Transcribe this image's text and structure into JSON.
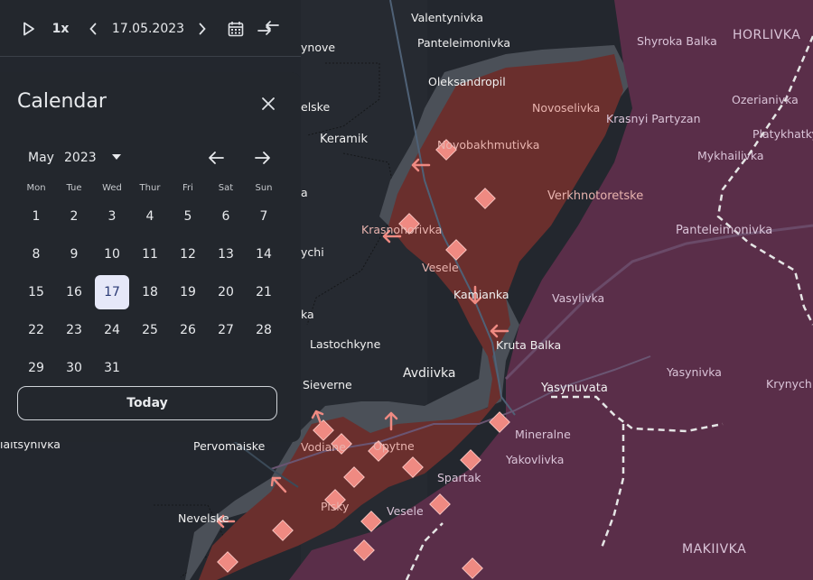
{
  "controls": {
    "play_icon": "play-icon",
    "speed": "1x",
    "date": "17.05.2023",
    "prev_icon": "chevron-left-icon",
    "next_icon": "chevron-right-icon",
    "calendar_icon": "calendar-icon",
    "compare_icon": "compare-arrows-icon"
  },
  "calendar": {
    "title": "Calendar",
    "close_icon": "close-icon",
    "month": "May",
    "year": "2023",
    "weekdays": [
      "Mon",
      "Tue",
      "Wed",
      "Thur",
      "Fri",
      "Sat",
      "Sun"
    ],
    "weeks": [
      [
        "1",
        "2",
        "3",
        "4",
        "5",
        "6",
        "7"
      ],
      [
        "8",
        "9",
        "10",
        "11",
        "12",
        "13",
        "14"
      ],
      [
        "15",
        "16",
        "17",
        "18",
        "19",
        "20",
        "21"
      ],
      [
        "22",
        "23",
        "24",
        "25",
        "26",
        "27",
        "28"
      ],
      [
        "29",
        "30",
        "31"
      ]
    ],
    "selected_day": "17",
    "today_label": "Today"
  },
  "map": {
    "colors": {
      "background": "#23272e",
      "occupied": "#5a2e49",
      "advance": "#6a2f2d",
      "grey_zone": "#4b5058",
      "front_marker": "#ef8a82"
    },
    "labels": {
      "valentynivka": "Valentynivka",
      "panteleimonivka_n": "Panteleimonivka",
      "oleksandropil": "Oleksandropil",
      "keramik": "Keramik",
      "ynove": "ynove",
      "elske": "elske",
      "novoselivka": "Novoselivka",
      "krasnyi_partyzan": "Krasnyi Partyzan",
      "shyroka_balka": "Shyroka Balka",
      "horlivka": "HORLIVKA",
      "ozerianivka": "Ozerianivka",
      "platykhatka": "Platykhatky",
      "mykhailivka": "Mykhailivka",
      "novobakhmutivka": "Novobakhmutivka",
      "verkhnotoretske": "Verkhnotoretske",
      "krasnohorivka": "Krasnohorivka",
      "panteleimonivka_e": "Panteleimonivka",
      "a_frag": "a",
      "vesele_n": "Vesele",
      "ychi": "ychi",
      "kamianka": "Kamianka",
      "vasylivka": "Vasylivka",
      "ka_frag": "ka",
      "lastochkyne": "Lastochkyne",
      "kruta_balka": "Kruta Balka",
      "avdiivka": "Avdiivka",
      "yasynivka": "Yasynivka",
      "sieverne": "Sieverne",
      "yasynuvata": "Yasynuvata",
      "krynychna": "Krynychna",
      "mineralne": "Mineralne",
      "aitsynivka": "laitsynivka",
      "pervomaiske": "Pervomaiske",
      "vodiane": "Vodiane",
      "opytne": "Opytne",
      "yakovlivka": "Yakovlivka",
      "spartak": "Spartak",
      "pisky": "Pisky",
      "nevelske": "Nevelske",
      "vesele_s": "Vesele",
      "makiivka": "MAKIIVKA"
    }
  }
}
